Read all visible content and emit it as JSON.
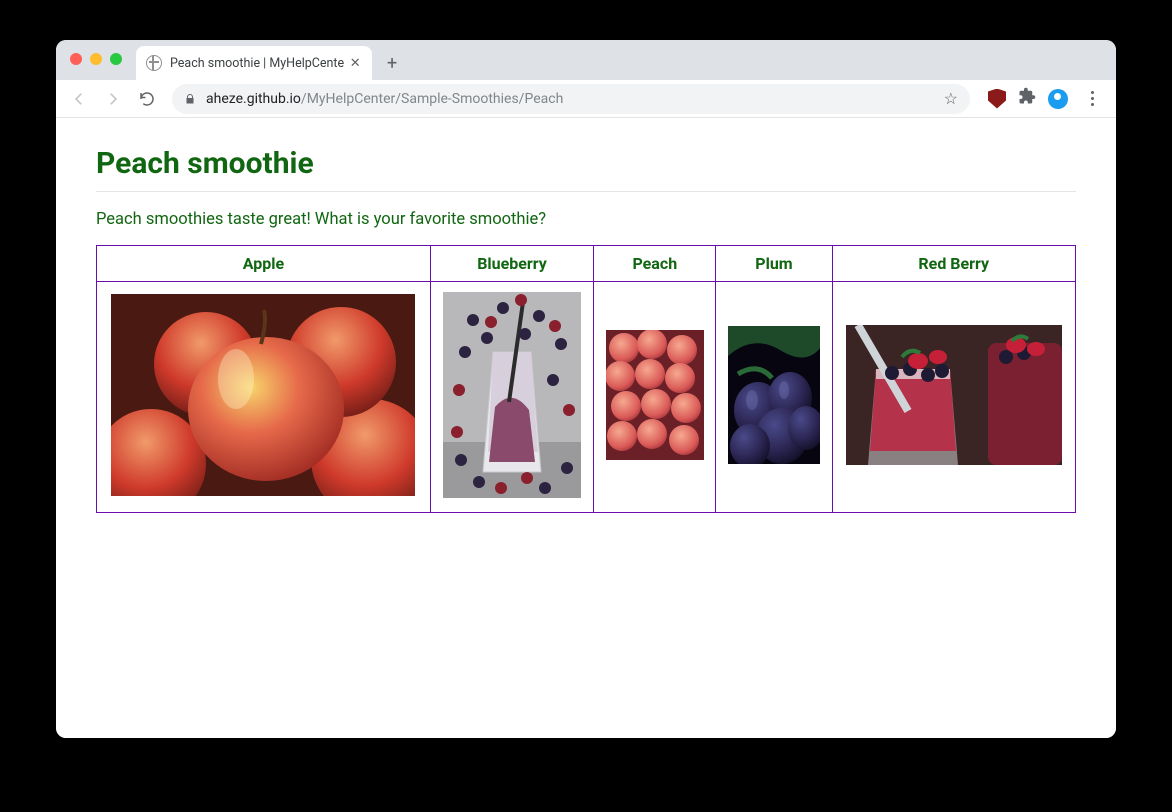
{
  "browser": {
    "tab_title": "Peach smoothie | MyHelpCente",
    "url_host": "aheze.github.io",
    "url_path": "/MyHelpCenter/Sample-Smoothies/Peach"
  },
  "page": {
    "heading": "Peach smoothie",
    "subtitle": "Peach smoothies taste great! What is your favorite smoothie?",
    "columns": [
      {
        "label": "Apple"
      },
      {
        "label": "Blueberry"
      },
      {
        "label": "Peach"
      },
      {
        "label": "Plum"
      },
      {
        "label": "Red Berry"
      }
    ]
  }
}
